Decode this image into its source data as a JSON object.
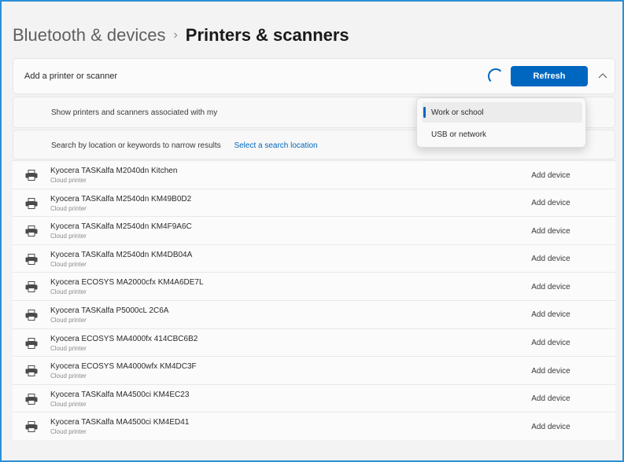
{
  "breadcrumb": {
    "parent": "Bluetooth & devices",
    "separator": "›",
    "current": "Printers & scanners"
  },
  "add_section": {
    "label": "Add a printer or scanner",
    "refresh_label": "Refresh",
    "collapse_icon": "chevron-up-icon"
  },
  "options": {
    "show_label": "Show printers and scanners associated with my",
    "search_label": "Search by location or keywords to narrow results",
    "search_link": "Select a search location"
  },
  "dropdown": {
    "selected": "Work or school",
    "other": "USB or network"
  },
  "printers": [
    {
      "name": "Kyocera TASKalfa M2040dn Kitchen",
      "sub": "Cloud printer",
      "action": "Add device"
    },
    {
      "name": "Kyocera TASKalfa M2540dn KM49B0D2",
      "sub": "Cloud printer",
      "action": "Add device"
    },
    {
      "name": "Kyocera TASKalfa M2540dn KM4F9A6C",
      "sub": "Cloud printer",
      "action": "Add device"
    },
    {
      "name": "Kyocera TASKalfa M2540dn KM4DB04A",
      "sub": "Cloud printer",
      "action": "Add device"
    },
    {
      "name": "Kyocera ECOSYS MA2000cfx KM4A6DE7L",
      "sub": "Cloud printer",
      "action": "Add device"
    },
    {
      "name": "Kyocera TASKalfa P5000cL 2C6A",
      "sub": "Cloud printer",
      "action": "Add device"
    },
    {
      "name": "Kyocera ECOSYS MA4000fx 414CBC6B2",
      "sub": "Cloud printer",
      "action": "Add device"
    },
    {
      "name": "Kyocera ECOSYS MA4000wfx KM4DC3F",
      "sub": "Cloud printer",
      "action": "Add device"
    },
    {
      "name": "Kyocera TASKalfa MA4500ci KM4EC23",
      "sub": "Cloud printer",
      "action": "Add device"
    },
    {
      "name": "Kyocera TASKalfa MA4500ci KM4ED41",
      "sub": "Cloud printer",
      "action": "Add device"
    }
  ],
  "colors": {
    "accent": "#0067c0",
    "frame_border": "#2b8fd6",
    "background": "#f3f3f3"
  }
}
